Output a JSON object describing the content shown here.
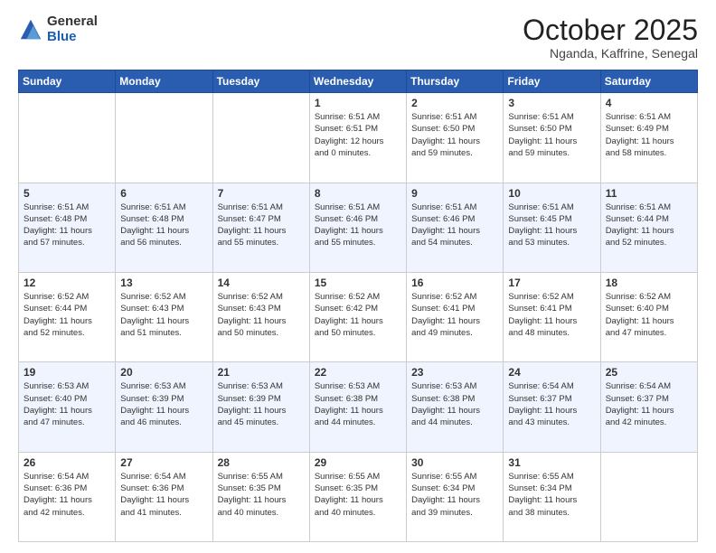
{
  "header": {
    "logo_general": "General",
    "logo_blue": "Blue",
    "month_year": "October 2025",
    "location": "Nganda, Kaffrine, Senegal"
  },
  "weekdays": [
    "Sunday",
    "Monday",
    "Tuesday",
    "Wednesday",
    "Thursday",
    "Friday",
    "Saturday"
  ],
  "rows": [
    [
      {
        "day": "",
        "text": ""
      },
      {
        "day": "",
        "text": ""
      },
      {
        "day": "",
        "text": ""
      },
      {
        "day": "1",
        "text": "Sunrise: 6:51 AM\nSunset: 6:51 PM\nDaylight: 12 hours\nand 0 minutes."
      },
      {
        "day": "2",
        "text": "Sunrise: 6:51 AM\nSunset: 6:50 PM\nDaylight: 11 hours\nand 59 minutes."
      },
      {
        "day": "3",
        "text": "Sunrise: 6:51 AM\nSunset: 6:50 PM\nDaylight: 11 hours\nand 59 minutes."
      },
      {
        "day": "4",
        "text": "Sunrise: 6:51 AM\nSunset: 6:49 PM\nDaylight: 11 hours\nand 58 minutes."
      }
    ],
    [
      {
        "day": "5",
        "text": "Sunrise: 6:51 AM\nSunset: 6:48 PM\nDaylight: 11 hours\nand 57 minutes."
      },
      {
        "day": "6",
        "text": "Sunrise: 6:51 AM\nSunset: 6:48 PM\nDaylight: 11 hours\nand 56 minutes."
      },
      {
        "day": "7",
        "text": "Sunrise: 6:51 AM\nSunset: 6:47 PM\nDaylight: 11 hours\nand 55 minutes."
      },
      {
        "day": "8",
        "text": "Sunrise: 6:51 AM\nSunset: 6:46 PM\nDaylight: 11 hours\nand 55 minutes."
      },
      {
        "day": "9",
        "text": "Sunrise: 6:51 AM\nSunset: 6:46 PM\nDaylight: 11 hours\nand 54 minutes."
      },
      {
        "day": "10",
        "text": "Sunrise: 6:51 AM\nSunset: 6:45 PM\nDaylight: 11 hours\nand 53 minutes."
      },
      {
        "day": "11",
        "text": "Sunrise: 6:51 AM\nSunset: 6:44 PM\nDaylight: 11 hours\nand 52 minutes."
      }
    ],
    [
      {
        "day": "12",
        "text": "Sunrise: 6:52 AM\nSunset: 6:44 PM\nDaylight: 11 hours\nand 52 minutes."
      },
      {
        "day": "13",
        "text": "Sunrise: 6:52 AM\nSunset: 6:43 PM\nDaylight: 11 hours\nand 51 minutes."
      },
      {
        "day": "14",
        "text": "Sunrise: 6:52 AM\nSunset: 6:43 PM\nDaylight: 11 hours\nand 50 minutes."
      },
      {
        "day": "15",
        "text": "Sunrise: 6:52 AM\nSunset: 6:42 PM\nDaylight: 11 hours\nand 50 minutes."
      },
      {
        "day": "16",
        "text": "Sunrise: 6:52 AM\nSunset: 6:41 PM\nDaylight: 11 hours\nand 49 minutes."
      },
      {
        "day": "17",
        "text": "Sunrise: 6:52 AM\nSunset: 6:41 PM\nDaylight: 11 hours\nand 48 minutes."
      },
      {
        "day": "18",
        "text": "Sunrise: 6:52 AM\nSunset: 6:40 PM\nDaylight: 11 hours\nand 47 minutes."
      }
    ],
    [
      {
        "day": "19",
        "text": "Sunrise: 6:53 AM\nSunset: 6:40 PM\nDaylight: 11 hours\nand 47 minutes."
      },
      {
        "day": "20",
        "text": "Sunrise: 6:53 AM\nSunset: 6:39 PM\nDaylight: 11 hours\nand 46 minutes."
      },
      {
        "day": "21",
        "text": "Sunrise: 6:53 AM\nSunset: 6:39 PM\nDaylight: 11 hours\nand 45 minutes."
      },
      {
        "day": "22",
        "text": "Sunrise: 6:53 AM\nSunset: 6:38 PM\nDaylight: 11 hours\nand 44 minutes."
      },
      {
        "day": "23",
        "text": "Sunrise: 6:53 AM\nSunset: 6:38 PM\nDaylight: 11 hours\nand 44 minutes."
      },
      {
        "day": "24",
        "text": "Sunrise: 6:54 AM\nSunset: 6:37 PM\nDaylight: 11 hours\nand 43 minutes."
      },
      {
        "day": "25",
        "text": "Sunrise: 6:54 AM\nSunset: 6:37 PM\nDaylight: 11 hours\nand 42 minutes."
      }
    ],
    [
      {
        "day": "26",
        "text": "Sunrise: 6:54 AM\nSunset: 6:36 PM\nDaylight: 11 hours\nand 42 minutes."
      },
      {
        "day": "27",
        "text": "Sunrise: 6:54 AM\nSunset: 6:36 PM\nDaylight: 11 hours\nand 41 minutes."
      },
      {
        "day": "28",
        "text": "Sunrise: 6:55 AM\nSunset: 6:35 PM\nDaylight: 11 hours\nand 40 minutes."
      },
      {
        "day": "29",
        "text": "Sunrise: 6:55 AM\nSunset: 6:35 PM\nDaylight: 11 hours\nand 40 minutes."
      },
      {
        "day": "30",
        "text": "Sunrise: 6:55 AM\nSunset: 6:34 PM\nDaylight: 11 hours\nand 39 minutes."
      },
      {
        "day": "31",
        "text": "Sunrise: 6:55 AM\nSunset: 6:34 PM\nDaylight: 11 hours\nand 38 minutes."
      },
      {
        "day": "",
        "text": ""
      }
    ]
  ]
}
